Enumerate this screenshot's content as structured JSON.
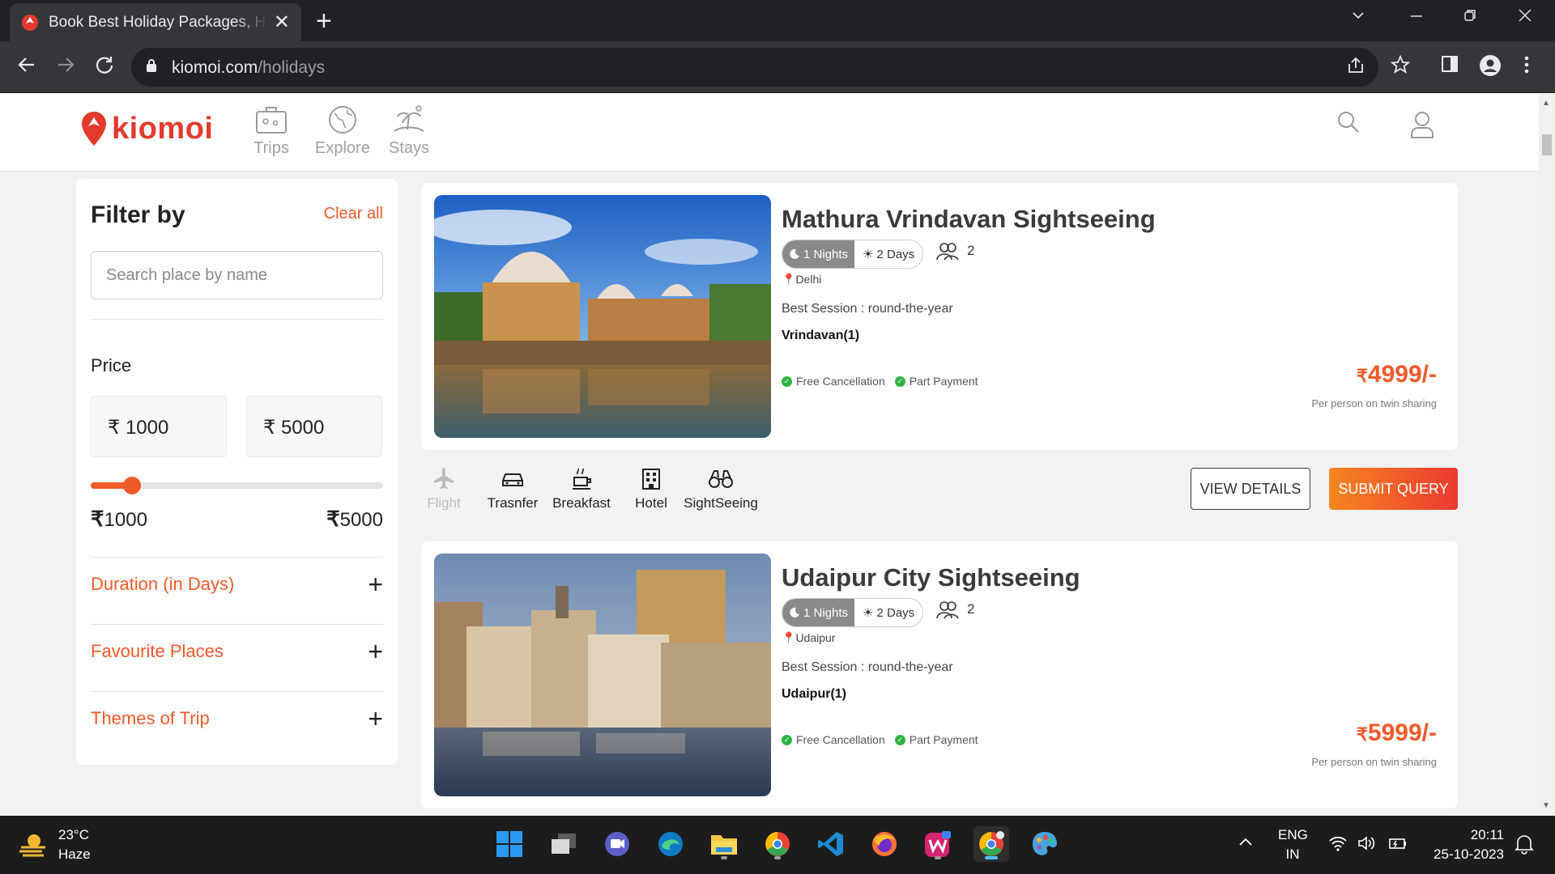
{
  "browser": {
    "tab_title": "Book Best Holiday Packages, Hol",
    "tab_close": "✕",
    "new_tab": "+",
    "url_domain": "kiomoi.com",
    "url_path": "/holidays"
  },
  "header": {
    "logo_text": "kiomoi",
    "nav": [
      {
        "label": "Trips",
        "icon": "suitcase-icon"
      },
      {
        "label": "Explore",
        "icon": "globe-icon"
      },
      {
        "label": "Stays",
        "icon": "island-icon"
      }
    ]
  },
  "sidebar": {
    "title": "Filter by",
    "clear_all": "Clear all",
    "search_placeholder": "Search place by name",
    "price_label": "Price",
    "min_price_input": "₹ 1000",
    "max_price_input": "₹ 5000",
    "range_min_label": "1000",
    "range_max_label": "5000",
    "slider_fraction": 0.14,
    "sections": [
      {
        "label": "Duration (in Days)",
        "toggle": "+"
      },
      {
        "label": "Favourite Places",
        "toggle": "+"
      },
      {
        "label": "Themes of Trip",
        "toggle": "+"
      }
    ]
  },
  "packages": [
    {
      "title": "Mathura Vrindavan Sightseeing",
      "nights": "1 Nights",
      "days": "2 Days",
      "pax": "2",
      "location": "Delhi",
      "season": "Best Session : round-the-year",
      "places": "Vrindavan(1)",
      "tags": [
        "Free Cancellation",
        "Part Payment"
      ],
      "price": "4999/-",
      "price_note": "Per person on twin sharing"
    },
    {
      "title": "Udaipur City Sightseeing",
      "nights": "1 Nights",
      "days": "2 Days",
      "pax": "2",
      "location": "Udaipur",
      "season": "Best Session : round-the-year",
      "places": "Udaipur(1)",
      "tags": [
        "Free Cancellation",
        "Part Payment"
      ],
      "price": "5999/-",
      "price_note": "Per person on twin sharing"
    }
  ],
  "amenities": [
    {
      "label": "Flight",
      "icon": "airplane-icon",
      "enabled": false
    },
    {
      "label": "Trasnfer",
      "icon": "car-icon",
      "enabled": true
    },
    {
      "label": "Breakfast",
      "icon": "breakfast-icon",
      "enabled": true
    },
    {
      "label": "Hotel",
      "icon": "hotel-icon",
      "enabled": true
    },
    {
      "label": "SightSeeing",
      "icon": "binoculars-icon",
      "enabled": true
    }
  ],
  "actions": {
    "view_details": "VIEW DETAILS",
    "submit_query": "SUBMIT QUERY"
  },
  "taskbar": {
    "temperature": "23°C",
    "weather": "Haze",
    "lang_line1": "ENG",
    "lang_line2": "IN",
    "time": "20:11",
    "date": "25-10-2023"
  },
  "colors": {
    "brand_orange": "#f0592a",
    "brand_red": "#e23b2e",
    "chrome_dark": "#202124"
  }
}
